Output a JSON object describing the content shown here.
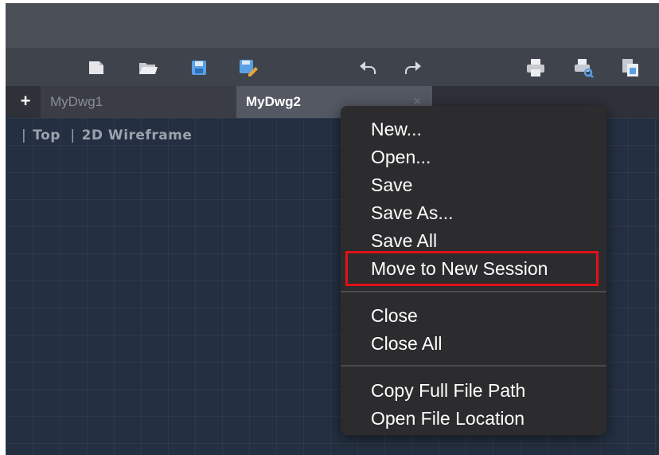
{
  "toolbar": {
    "icons": [
      "new-file-icon",
      "open-folder-icon",
      "save-icon",
      "save-as-icon",
      "undo-icon",
      "redo-icon",
      "print-icon",
      "plot-preview-icon",
      "publish-icon"
    ]
  },
  "tabs": [
    {
      "label": "MyDwg1",
      "active": false
    },
    {
      "label": "MyDwg2",
      "active": true,
      "close": "×"
    }
  ],
  "tab_add": "+",
  "viewport": {
    "view": "Top",
    "visual_style": "2D Wireframe"
  },
  "context_menu": {
    "items": [
      "New...",
      "Open...",
      "Save",
      "Save As...",
      "Save All",
      "Move to New Session",
      "Close",
      "Close All",
      "Copy Full File Path",
      "Open File Location"
    ],
    "highlighted": "Move to New Session",
    "highlight_color": "#e0121a"
  },
  "colors": {
    "canvas": "#243041",
    "toolbar": "#3f434b",
    "active_tab": "#545862",
    "menu": "#2c2c2e",
    "save_icon_blue": "#5aa0e6"
  }
}
